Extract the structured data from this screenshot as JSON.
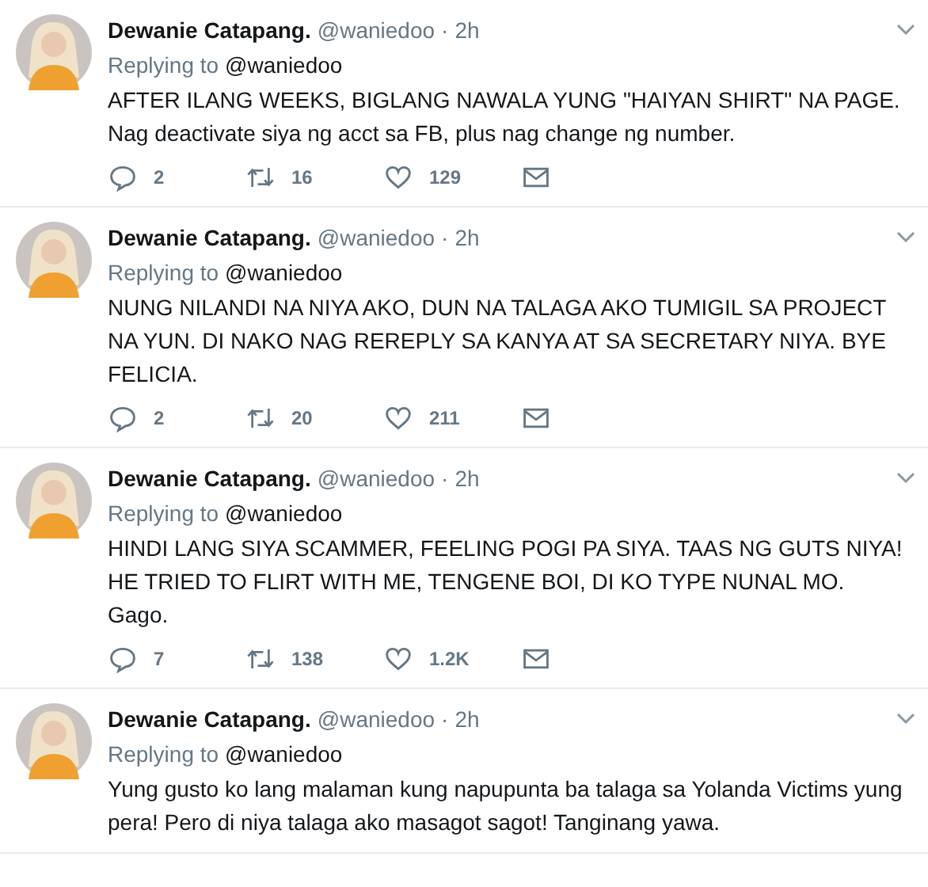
{
  "tweets": [
    {
      "name": "Dewanie Catapang.",
      "handle": "@waniedoo",
      "separator": "·",
      "time": "2h",
      "replying_label": "Replying to",
      "replying_to": "@waniedoo",
      "text": "AFTER ILANG WEEKS, BIGLANG NAWALA YUNG \"HAIYAN SHIRT\" NA PAGE. Nag deactivate siya ng acct sa FB, plus nag change ng number.",
      "actions": {
        "replies": "2",
        "retweets": "16",
        "likes": "129"
      }
    },
    {
      "name": "Dewanie Catapang.",
      "handle": "@waniedoo",
      "separator": "·",
      "time": "2h",
      "replying_label": "Replying to",
      "replying_to": "@waniedoo",
      "text": "NUNG NILANDI NA NIYA AKO, DUN NA TALAGA AKO TUMIGIL SA PROJECT NA YUN. DI NAKO NAG REREPLY SA KANYA AT SA SECRETARY NIYA. BYE FELICIA.",
      "actions": {
        "replies": "2",
        "retweets": "20",
        "likes": "211"
      }
    },
    {
      "name": "Dewanie Catapang.",
      "handle": "@waniedoo",
      "separator": "·",
      "time": "2h",
      "replying_label": "Replying to",
      "replying_to": "@waniedoo",
      "text": "HINDI LANG SIYA SCAMMER, FEELING POGI PA SIYA. TAAS NG GUTS NIYA! HE TRIED TO FLIRT WITH ME, TENGENE BOI, DI KO TYPE NUNAL MO. Gago.",
      "actions": {
        "replies": "7",
        "retweets": "138",
        "likes": "1.2K"
      }
    },
    {
      "name": "Dewanie Catapang.",
      "handle": "@waniedoo",
      "separator": "·",
      "time": "2h",
      "replying_label": "Replying to",
      "replying_to": "@waniedoo",
      "text": "Yung gusto ko lang malaman kung napupunta ba talaga sa Yolanda Victims yung pera! Pero di niya talaga ako masagot sagot! Tanginang yawa."
    }
  ]
}
